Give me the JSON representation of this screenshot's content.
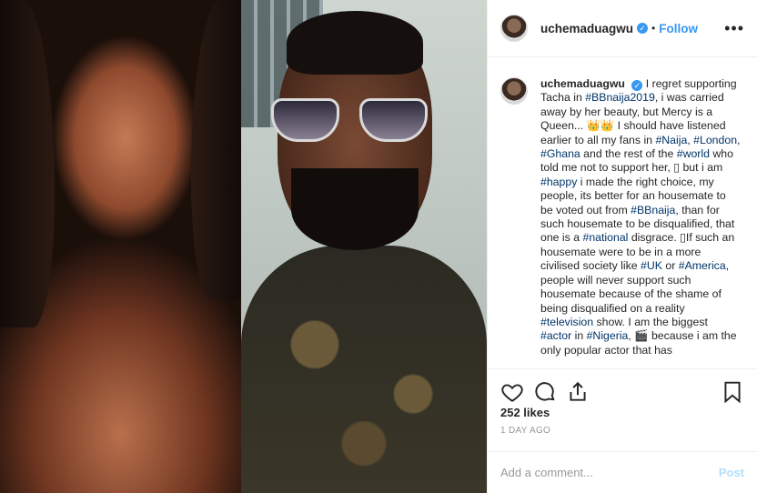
{
  "post": {
    "username": "uchemaduagwu",
    "verified_icon": "verified-badge-icon",
    "follow_label": "Follow",
    "more_icon": "more-options-icon",
    "caption_parts": [
      {
        "t": "I regret supporting Tacha in "
      },
      {
        "t": "#BBnaija2019",
        "tag": true
      },
      {
        "t": ", i was carried away by her beauty, but Mercy is a Queen... 👑👑 I should have listened earlier to all my fans in "
      },
      {
        "t": "#Naija",
        "tag": true
      },
      {
        "t": ", "
      },
      {
        "t": "#London",
        "tag": true
      },
      {
        "t": ", "
      },
      {
        "t": "#Ghana",
        "tag": true
      },
      {
        "t": " and the rest of the "
      },
      {
        "t": "#world",
        "tag": true
      },
      {
        "t": " who told me not to support her, ▯ but i am "
      },
      {
        "t": "#happy",
        "tag": true
      },
      {
        "t": " i made the right choice, my people, its better for an housemate to be voted out from "
      },
      {
        "t": "#BBnaija",
        "tag": true
      },
      {
        "t": ", than for such housemate to be disqualified, that one is a "
      },
      {
        "t": "#national",
        "tag": true
      },
      {
        "t": " disgrace. ▯If such an housemate were to be in a more civilised society like "
      },
      {
        "t": "#UK",
        "tag": true
      },
      {
        "t": " or "
      },
      {
        "t": "#America",
        "tag": true
      },
      {
        "t": ", people will never support such housemate because of the shame of being disqualified on a reality "
      },
      {
        "t": "#television",
        "tag": true
      },
      {
        "t": " show. I am the biggest "
      },
      {
        "t": "#actor",
        "tag": true
      },
      {
        "t": " in "
      },
      {
        "t": "#Nigeria",
        "tag": true
      },
      {
        "t": ", 🎬 because i am the only popular actor that has"
      }
    ],
    "likes": "252 likes",
    "time": "1 DAY AGO",
    "comment_placeholder": "Add a comment...",
    "post_label": "Post"
  },
  "icons": {
    "like": "heart-icon",
    "comment": "comment-icon",
    "share": "share-icon",
    "save": "bookmark-icon"
  },
  "colors": {
    "link": "#3897f0",
    "hashtag": "#003569",
    "post_disabled": "#b2dffc"
  }
}
